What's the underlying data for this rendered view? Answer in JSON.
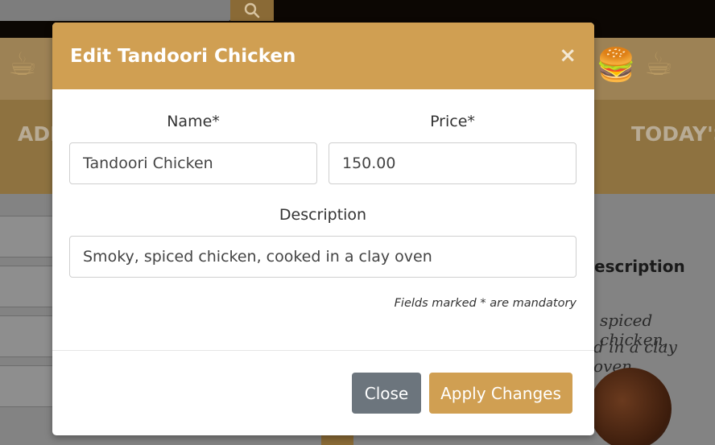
{
  "background": {
    "nav_left_text": "ADI",
    "nav_right_text": "TODAY'S",
    "column_heading": "escription",
    "row_description_line1": "spiced chicken,",
    "row_description_line2": "d in a clay oven"
  },
  "modal": {
    "title": "Edit Tandoori Chicken",
    "close_symbol": "×",
    "name_label": "Name*",
    "name_value": "Tandoori Chicken",
    "price_label": "Price*",
    "price_value": "150.00",
    "description_label": "Description",
    "description_value": "Smoky, spiced chicken, cooked in a clay oven",
    "mandatory_note": "Fields marked * are mandatory",
    "close_button": "Close",
    "apply_button": "Apply Changes"
  },
  "colors": {
    "header": "#d09f52",
    "apply_button": "#d09f52",
    "close_button": "#6c757d"
  },
  "icons": {
    "search": "search-icon",
    "close": "close-icon"
  }
}
